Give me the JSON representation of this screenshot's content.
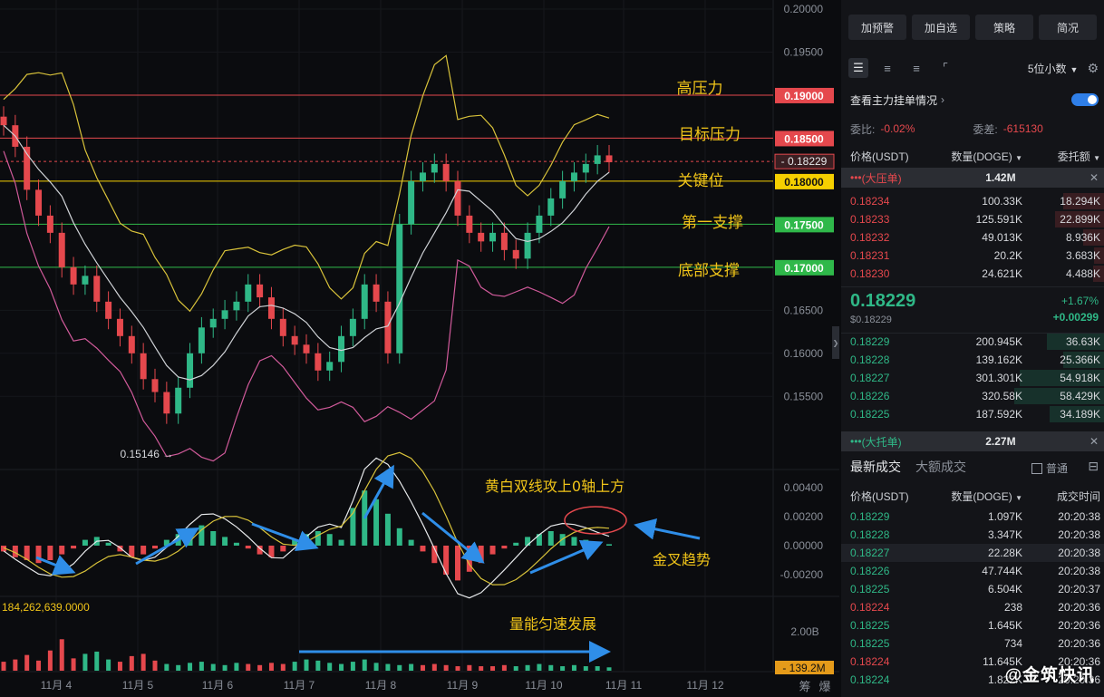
{
  "chart_data": {
    "type": "candlestick",
    "instrument": "DOGE/USDT",
    "x_ticks": [
      "11月 4",
      "11月 5",
      "11月 6",
      "11月 7",
      "11月 8",
      "11月 9",
      "11月 10",
      "11月 11",
      "11月 12"
    ],
    "price_axis": {
      "ticks": [
        "0.20000",
        "0.19500",
        "0.19000",
        "0.18500",
        "0.18000",
        "0.17500",
        "0.17000",
        "0.16500",
        "0.16000",
        "0.15500"
      ],
      "range": [
        0.1505,
        0.2
      ]
    },
    "levels": [
      {
        "name": "高压力",
        "value": "0.19000",
        "color": "#e5484d"
      },
      {
        "name": "目标压力",
        "value": "0.18500",
        "color": "#e5484d"
      },
      {
        "name": "关键位",
        "value": "0.18000",
        "color": "#f5d000"
      },
      {
        "name": "第一支撑",
        "value": "0.17500",
        "color": "#2fb84a"
      },
      {
        "name": "底部支撑",
        "value": "0.17000",
        "color": "#2fb84a"
      }
    ],
    "current_price_label": "0.18229",
    "low_label": "0.15146",
    "candles_close": [
      0.1865,
      0.184,
      0.179,
      0.176,
      0.174,
      0.17,
      0.168,
      0.169,
      0.166,
      0.164,
      0.162,
      0.16,
      0.157,
      0.1555,
      0.153,
      0.156,
      0.16,
      0.163,
      0.164,
      0.165,
      0.166,
      0.168,
      0.1665,
      0.164,
      0.162,
      0.161,
      0.16,
      0.158,
      0.159,
      0.162,
      0.164,
      0.168,
      0.166,
      0.16,
      0.175,
      0.18,
      0.181,
      0.182,
      0.18,
      0.176,
      0.174,
      0.173,
      0.174,
      0.172,
      0.171,
      0.174,
      0.176,
      0.178,
      0.18,
      0.181,
      0.182,
      0.183,
      0.1822
    ],
    "macd_axis": {
      "ticks": [
        "0.00400",
        "0.00200",
        "0.00000",
        "-0.00200"
      ],
      "range": [
        -0.003,
        0.005
      ]
    },
    "macd_hist": [
      -0.0004,
      -0.0008,
      -0.001,
      -0.0012,
      -0.001,
      -0.0006,
      -0.0002,
      0.0004,
      0.0006,
      0.0002,
      -0.0004,
      -0.0008,
      -0.0006,
      -0.0002,
      0.0004,
      0.0008,
      0.0012,
      0.0014,
      0.001,
      0.0006,
      0.0002,
      -0.0002,
      -0.0006,
      -0.0008,
      -0.0004,
      0.0004,
      0.0008,
      0.001,
      0.0008,
      0.0004,
      0.0026,
      0.0038,
      0.0032,
      0.0022,
      0.0012,
      0.0004,
      -0.0004,
      -0.0012,
      -0.002,
      -0.0024,
      -0.0018,
      -0.0012,
      -0.0006,
      -0.0002,
      0.0002,
      0.0006,
      0.0008,
      0.001,
      0.0008,
      0.0006,
      0.0004,
      0.0002,
      0.0001
    ],
    "volume_axis": {
      "ticks": [
        "2.00B",
        "139.2M"
      ]
    },
    "volume_label": "184,262,639.0000",
    "volume_values": [
      0.16,
      0.2,
      0.28,
      0.18,
      0.36,
      0.56,
      0.22,
      0.3,
      0.34,
      0.2,
      0.16,
      0.26,
      0.3,
      0.18,
      0.12,
      0.1,
      0.14,
      0.16,
      0.12,
      0.1,
      0.14,
      0.12,
      0.1,
      0.14,
      0.12,
      0.16,
      0.2,
      0.18,
      0.14,
      0.12,
      0.16,
      0.2,
      0.14,
      0.12,
      0.1,
      0.12,
      0.1,
      0.12,
      0.1,
      0.08,
      0.1,
      0.08,
      0.08,
      0.1,
      0.08,
      0.1,
      0.12,
      0.1,
      0.08,
      0.1,
      0.08,
      0.08,
      0.06
    ],
    "annotations": [
      "黄白双线攻上0轴上方",
      "金叉趋势",
      "量能匀速发展"
    ],
    "bottom_buttons": [
      "筹",
      "爆"
    ]
  },
  "panel": {
    "buttons": [
      "加预警",
      "加自选",
      "策略",
      "简况"
    ],
    "precision": "5位小数",
    "main_orders_label": "查看主力挂单情况",
    "weibi_label": "委比:",
    "weibi_value": "-0.02%",
    "weicha_label": "委差:",
    "weicha_value": "-615130",
    "headers": {
      "price": "价格(USDT)",
      "qty": "数量(DOGE)",
      "amount": "委托额"
    },
    "big_sell": {
      "label": "(大压单)",
      "qty": "1.42M"
    },
    "asks": [
      {
        "price": "0.18234",
        "qty": "100.33K",
        "amt": "18.294K",
        "depth": 0.3
      },
      {
        "price": "0.18233",
        "qty": "125.591K",
        "amt": "22.899K",
        "depth": 0.36
      },
      {
        "price": "0.18232",
        "qty": "49.013K",
        "amt": "8.936K",
        "depth": 0.15
      },
      {
        "price": "0.18231",
        "qty": "20.2K",
        "amt": "3.683K",
        "depth": 0.07
      },
      {
        "price": "0.18230",
        "qty": "24.621K",
        "amt": "4.488K",
        "depth": 0.08
      }
    ],
    "last_price": "0.18229",
    "last_price_usd": "$0.18229",
    "change_pct": "+1.67%",
    "change_abs": "+0.00299",
    "bids": [
      {
        "price": "0.18229",
        "qty": "200.945K",
        "amt": "36.63K",
        "depth": 0.42
      },
      {
        "price": "0.18228",
        "qty": "139.162K",
        "amt": "25.366K",
        "depth": 0.3
      },
      {
        "price": "0.18227",
        "qty": "301.301K",
        "amt": "54.918K",
        "depth": 0.62
      },
      {
        "price": "0.18226",
        "qty": "320.58K",
        "amt": "58.429K",
        "depth": 0.66
      },
      {
        "price": "0.18225",
        "qty": "187.592K",
        "amt": "34.189K",
        "depth": 0.4
      }
    ],
    "big_buy": {
      "label": "(大托单)",
      "qty": "2.27M"
    },
    "trade_tabs": [
      "最新成交",
      "大额成交"
    ],
    "trade_filter": "普通",
    "trade_headers": {
      "price": "价格(USDT)",
      "qty": "数量(DOGE)",
      "time": "成交时间"
    },
    "trades": [
      {
        "price": "0.18229",
        "qty": "1.097K",
        "time": "20:20:38",
        "side": "buy"
      },
      {
        "price": "0.18228",
        "qty": "3.347K",
        "time": "20:20:38",
        "side": "buy"
      },
      {
        "price": "0.18227",
        "qty": "22.28K",
        "time": "20:20:38",
        "side": "buy"
      },
      {
        "price": "0.18226",
        "qty": "47.744K",
        "time": "20:20:38",
        "side": "buy"
      },
      {
        "price": "0.18225",
        "qty": "6.504K",
        "time": "20:20:37",
        "side": "buy"
      },
      {
        "price": "0.18224",
        "qty": "238",
        "time": "20:20:36",
        "side": "sell"
      },
      {
        "price": "0.18225",
        "qty": "1.645K",
        "time": "20:20:36",
        "side": "buy"
      },
      {
        "price": "0.18225",
        "qty": "734",
        "time": "20:20:36",
        "side": "buy"
      },
      {
        "price": "0.18224",
        "qty": "11.645K",
        "time": "20:20:36",
        "side": "sell"
      },
      {
        "price": "0.18224",
        "qty": "1.822K",
        "time": "20:20:36",
        "side": "buy"
      }
    ],
    "watermark": "@金筑快讯"
  }
}
